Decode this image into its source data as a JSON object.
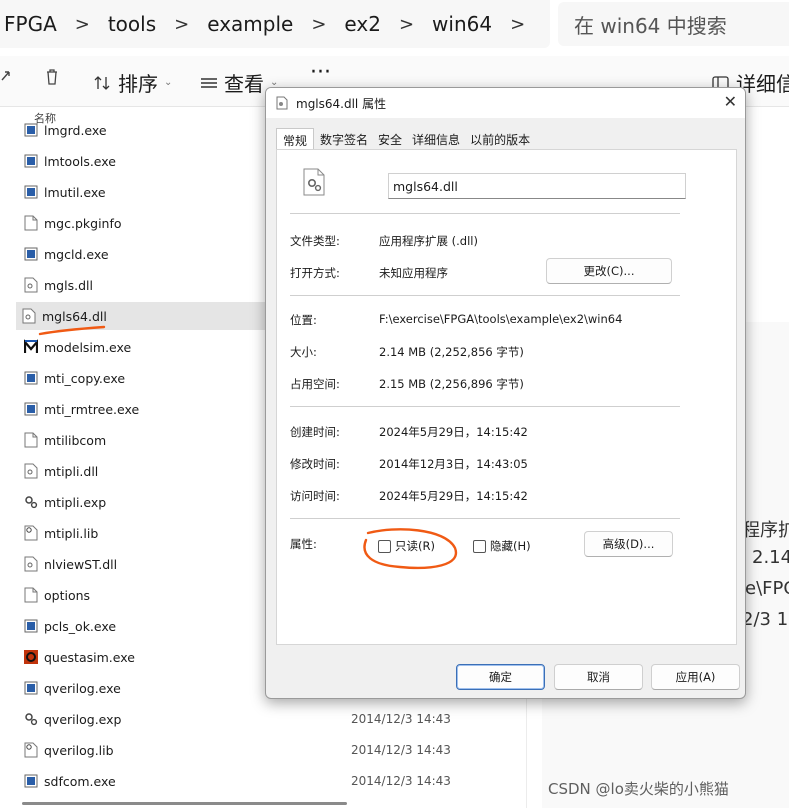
{
  "address": {
    "crumbs": [
      "FPGA",
      "tools",
      "example",
      "ex2",
      "win64"
    ],
    "search_placeholder": "在 win64 中搜索"
  },
  "toolbar": {
    "sort_label": "排序",
    "view_label": "查看",
    "more_label": "···",
    "details_label": "详细信"
  },
  "column_header": "名称",
  "files": [
    {
      "name": "lmgrd.exe",
      "icon": "exe-icon",
      "date": ""
    },
    {
      "name": "lmtools.exe",
      "icon": "exe-icon",
      "date": ""
    },
    {
      "name": "lmutil.exe",
      "icon": "exe-icon",
      "date": ""
    },
    {
      "name": "mgc.pkginfo",
      "icon": "file-icon",
      "date": ""
    },
    {
      "name": "mgcld.exe",
      "icon": "exe-icon",
      "date": ""
    },
    {
      "name": "mgls.dll",
      "icon": "dll-icon",
      "date": ""
    },
    {
      "name": "mgls64.dll",
      "icon": "dll-icon",
      "date": ""
    },
    {
      "name": "modelsim.exe",
      "icon": "modelsim-icon",
      "date": ""
    },
    {
      "name": "mti_copy.exe",
      "icon": "exe-icon",
      "date": ""
    },
    {
      "name": "mti_rmtree.exe",
      "icon": "exe-icon",
      "date": ""
    },
    {
      "name": "mtilibcom",
      "icon": "file-icon",
      "date": ""
    },
    {
      "name": "mtipli.dll",
      "icon": "dll-icon",
      "date": ""
    },
    {
      "name": "mtipli.exp",
      "icon": "exp-icon",
      "date": ""
    },
    {
      "name": "mtipli.lib",
      "icon": "lib-icon",
      "date": ""
    },
    {
      "name": "nlviewST.dll",
      "icon": "dll-icon",
      "date": ""
    },
    {
      "name": "options",
      "icon": "file-icon",
      "date": ""
    },
    {
      "name": "pcls_ok.exe",
      "icon": "exe-icon",
      "date": ""
    },
    {
      "name": "questasim.exe",
      "icon": "questasim-icon",
      "date": ""
    },
    {
      "name": "qverilog.exe",
      "icon": "exe-icon",
      "date": ""
    },
    {
      "name": "qverilog.exp",
      "icon": "exp-icon",
      "date": "2014/12/3 14:43"
    },
    {
      "name": "qverilog.lib",
      "icon": "lib-icon",
      "date": "2014/12/3 14:43"
    },
    {
      "name": "sdfcom.exe",
      "icon": "exe-icon",
      "date": "2014/12/3 14:43"
    }
  ],
  "selected_file": "mgls64.dll",
  "right_pane": {
    "line1": "程序扩",
    "line2": "2.14",
    "line3": "e\\FPG",
    "line4": "2/3 14"
  },
  "dialog": {
    "title": "mgls64.dll 属性",
    "tabs": [
      "常规",
      "数字签名",
      "安全",
      "详细信息",
      "以前的版本"
    ],
    "active_tab": "常规",
    "file_name": "mgls64.dll",
    "rows": {
      "file_type_label": "文件类型:",
      "file_type_value": "应用程序扩展 (.dll)",
      "open_with_label": "打开方式:",
      "open_with_value": "未知应用程序",
      "change_button": "更改(C)...",
      "location_label": "位置:",
      "location_value": "F:\\exercise\\FPGA\\tools\\example\\ex2\\win64",
      "size_label": "大小:",
      "size_value": "2.14 MB (2,252,856 字节)",
      "disk_label": "占用空间:",
      "disk_value": "2.15 MB (2,256,896 字节)",
      "created_label": "创建时间:",
      "created_value": "2024年5月29日，14:15:42",
      "modified_label": "修改时间:",
      "modified_value": "2014年12月3日，14:43:05",
      "accessed_label": "访问时间:",
      "accessed_value": "2024年5月29日，14:15:42",
      "attributes_label": "属性:",
      "readonly_label": "只读(R)",
      "readonly_checked": false,
      "hidden_label": "隐藏(H)",
      "hidden_checked": false,
      "advanced_button": "高级(D)..."
    },
    "footer": {
      "ok": "确定",
      "cancel": "取消",
      "apply": "应用(A)"
    }
  },
  "watermark": "CSDN @lo卖火柴的小熊猫",
  "colors": {
    "annotation": "#f05a14",
    "selection": "#e5e5e5",
    "dialog_bg": "#f0f0f0",
    "primary_border": "#3b6fb6"
  }
}
